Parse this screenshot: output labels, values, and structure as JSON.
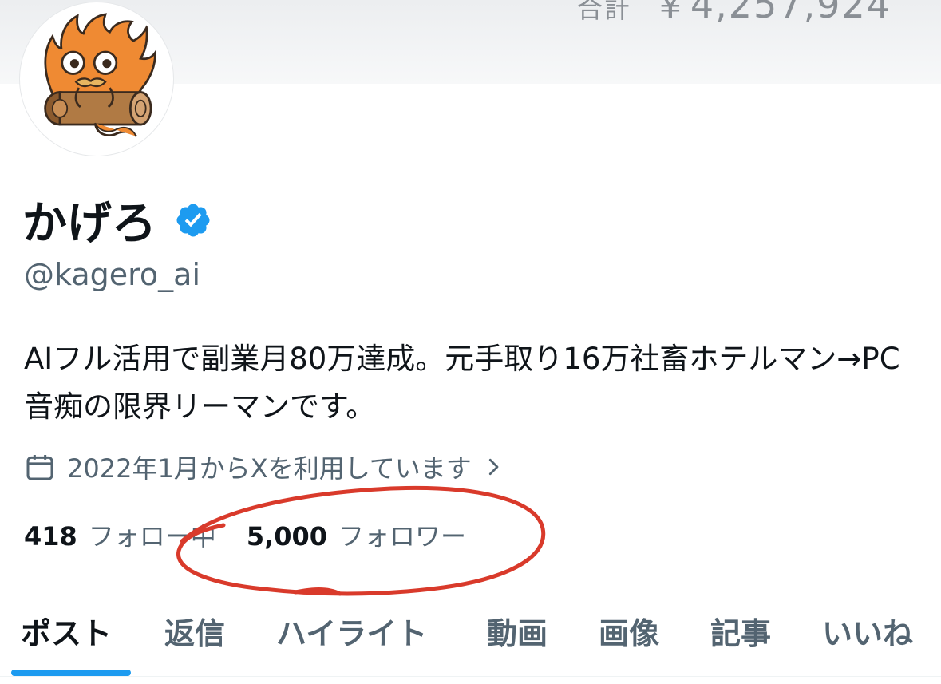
{
  "banner": {
    "label": "合計",
    "amount": "￥4,257,924"
  },
  "profile": {
    "display_name": "かげろ",
    "handle": "@kagero_ai",
    "bio": "AIフル活用で副業月80万達成。元手取り16万社畜ホテルマン→PC音痴の限界リーマンです。",
    "joined": "2022年1月からXを利用しています",
    "following_count": "418",
    "following_label": "フォロー中",
    "followers_count": "5,000",
    "followers_label": "フォロワー"
  },
  "tabs": [
    {
      "label": "ポスト",
      "active": true
    },
    {
      "label": "返信"
    },
    {
      "label": "ハイライト"
    },
    {
      "label": "動画"
    },
    {
      "label": "画像"
    },
    {
      "label": "記事"
    },
    {
      "label": "いいね"
    }
  ],
  "colors": {
    "accent": "#1d9bf0",
    "verified": "#1d9bf0",
    "annotation": "#d93a2b",
    "secondary_text": "#536471",
    "primary_text": "#0f1419"
  },
  "icons": {
    "verified": "verified-badge-icon",
    "calendar": "calendar-icon",
    "chevron": "chevron-right-icon"
  }
}
